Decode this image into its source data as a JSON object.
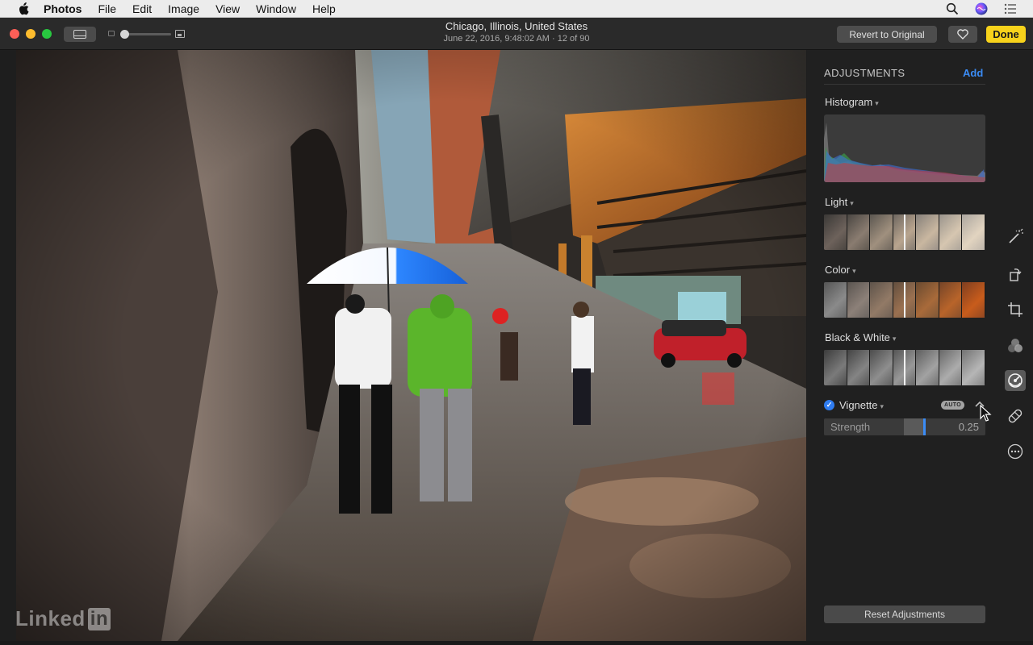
{
  "menubar": {
    "apple_icon": "apple-icon",
    "items": [
      "Photos",
      "File",
      "Edit",
      "Image",
      "View",
      "Window",
      "Help"
    ],
    "right_icons": [
      "search-icon",
      "siri-icon",
      "notification-center-icon"
    ]
  },
  "toolbar": {
    "location": "Chicago, Illinois, United States",
    "subtitle": "June 22, 2016, 9:48:02 AM  ·  12 of 90",
    "revert_label": "Revert to Original",
    "done_label": "Done",
    "favorite_icon": "heart-icon"
  },
  "watermark": {
    "text": "Linked",
    "suffix": "in"
  },
  "adjustments": {
    "title": "ADJUSTMENTS",
    "add_label": "Add",
    "histogram_label": "Histogram",
    "light_label": "Light",
    "color_label": "Color",
    "bw_label": "Black & White",
    "vignette": {
      "label": "Vignette",
      "enabled": true,
      "auto_badge": "AUTO",
      "strength_label": "Strength",
      "strength_value": "0.25",
      "strength_fraction": 0.25
    },
    "reset_label": "Reset Adjustments"
  },
  "tools": [
    "magic-wand-icon",
    "rotate-icon",
    "crop-icon",
    "filters-icon",
    "adjust-icon",
    "retouch-icon",
    "more-icon"
  ],
  "colors": {
    "done": "#f7d21b",
    "accent": "#3b8cf5",
    "panel": "#202020"
  }
}
